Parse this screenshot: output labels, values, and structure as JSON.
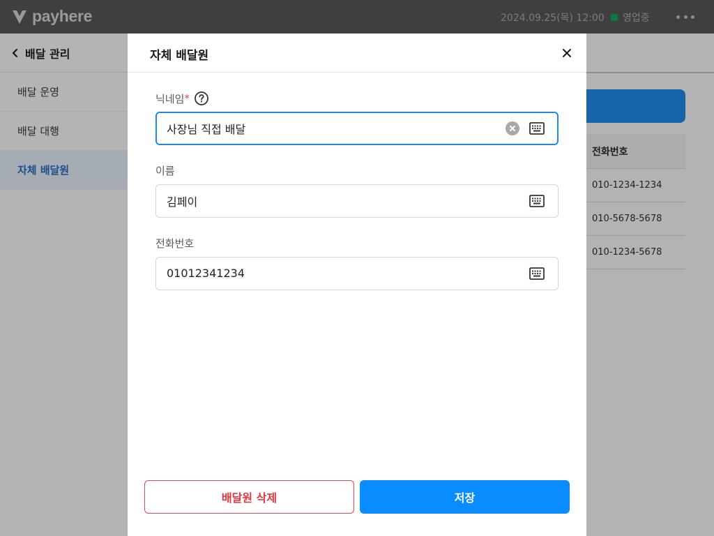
{
  "app": {
    "brand": "payhere",
    "datetime": "2024.09.25(목) 12:00",
    "status": "영업중"
  },
  "sidebar": {
    "title": "배달 관리",
    "items": [
      {
        "label": "배달 운영",
        "active": false
      },
      {
        "label": "배달 대행",
        "active": false
      },
      {
        "label": "자체 배달원",
        "active": true
      }
    ]
  },
  "background_table": {
    "header": "전화번호",
    "rows": [
      "010-1234-1234",
      "010-5678-5678",
      "010-1234-5678"
    ]
  },
  "modal": {
    "title": "자체 배달원",
    "fields": {
      "nickname": {
        "label": "닉네임",
        "required_mark": "*",
        "value": "사장님 직접 배달"
      },
      "name": {
        "label": "이름",
        "value": "김페이"
      },
      "phone": {
        "label": "전화번호",
        "value": "01012341234"
      }
    },
    "delete_label": "배달원 삭제",
    "save_label": "저장"
  },
  "colors": {
    "accent": "#0a8cff",
    "focus_border": "#1a8be6",
    "danger": "#e5393f",
    "status_green": "#0b7a3c"
  }
}
